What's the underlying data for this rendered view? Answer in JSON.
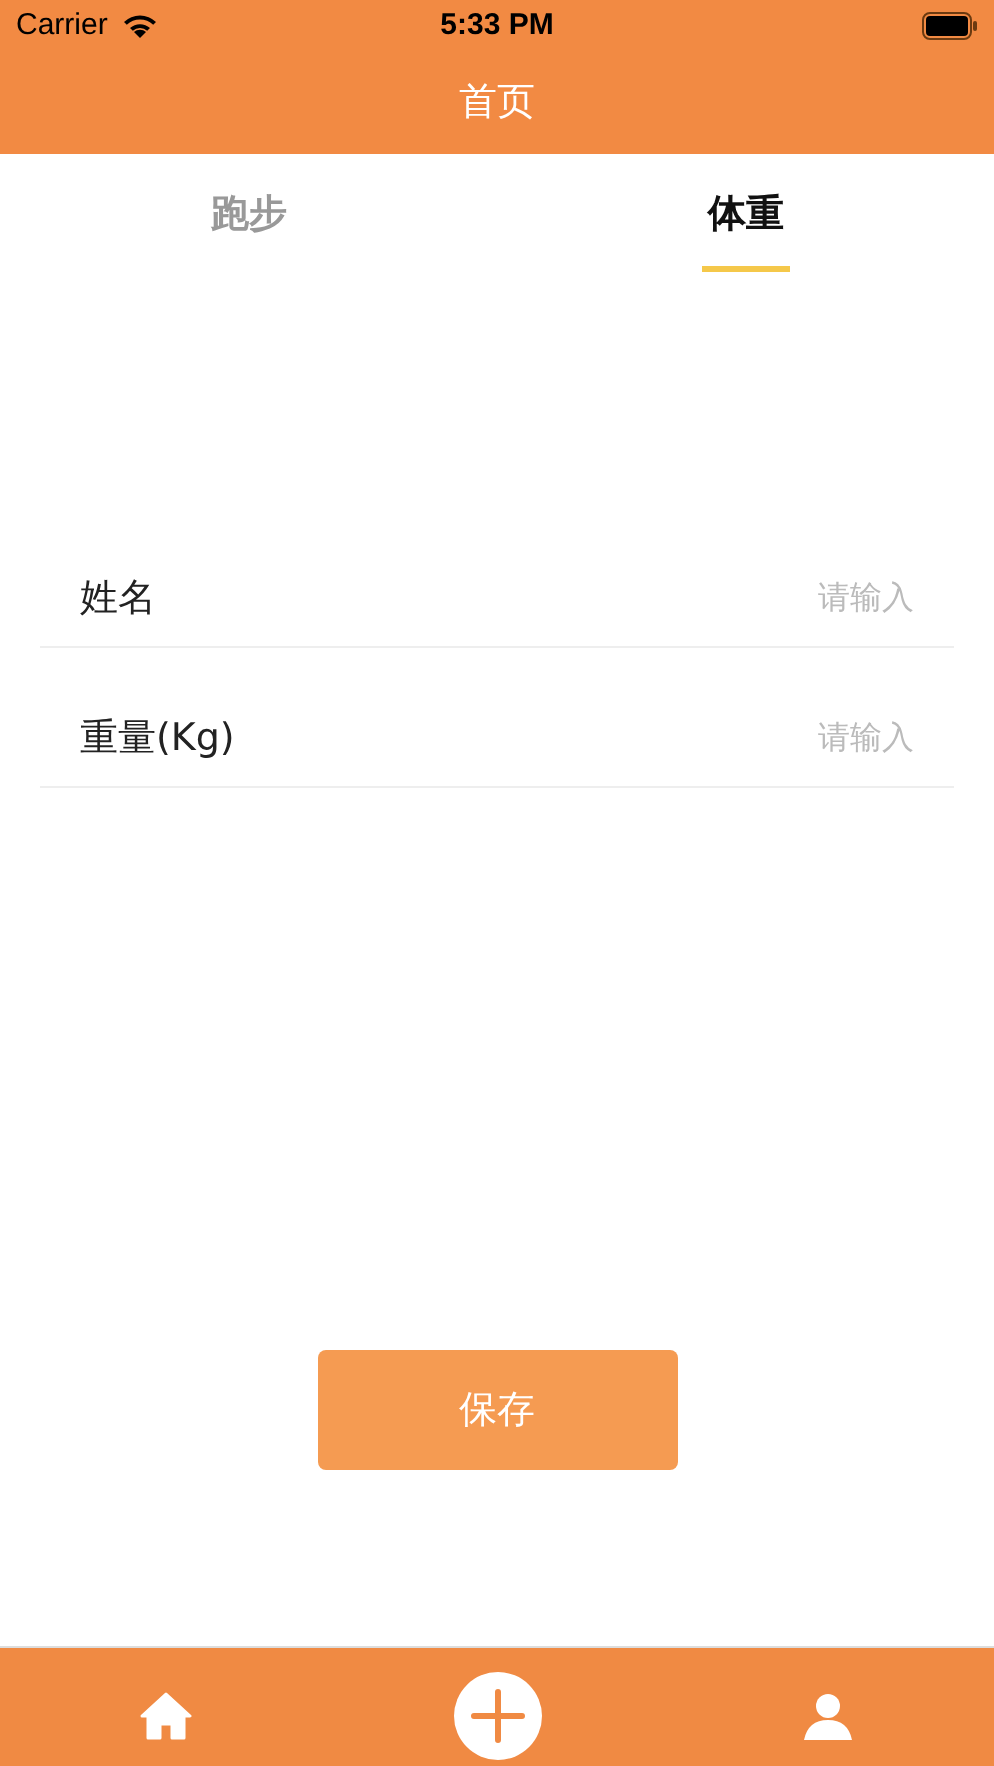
{
  "status_bar": {
    "carrier": "Carrier",
    "time": "5:33 PM"
  },
  "nav_bar": {
    "title": "首页"
  },
  "tabs": [
    {
      "label": "跑步",
      "selected": false
    },
    {
      "label": "体重",
      "selected": true
    }
  ],
  "form": {
    "fields": [
      {
        "label": "姓名",
        "placeholder": "请输入"
      },
      {
        "label": "重量(Kg)",
        "placeholder": "请输入"
      }
    ]
  },
  "save_button": "保存",
  "tab_bar": {
    "items": [
      {
        "kind": "home"
      },
      {
        "kind": "add"
      },
      {
        "kind": "profile"
      }
    ]
  }
}
